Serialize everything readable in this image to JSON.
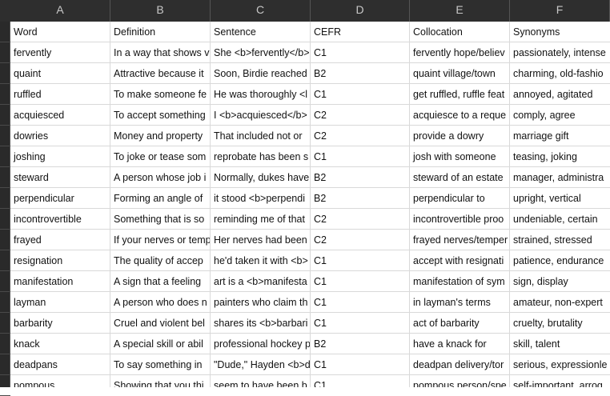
{
  "columns": [
    "A",
    "B",
    "C",
    "D",
    "E",
    "F"
  ],
  "header": [
    "Word",
    "Definition",
    "Sentence",
    "CEFR",
    "Collocation",
    "Synonyms"
  ],
  "rows": [
    [
      "fervently",
      "In a way that shows v",
      "She <b>fervently</b>",
      "C1",
      "fervently hope/believ",
      "passionately, intense"
    ],
    [
      "quaint",
      "Attractive because it",
      "Soon, Birdie reached",
      "B2",
      "quaint village/town",
      "charming, old-fashio"
    ],
    [
      "ruffled",
      "To make someone fe",
      "He was thoroughly <l",
      "C1",
      "get ruffled, ruffle feat",
      "annoyed, agitated"
    ],
    [
      "acquiesced",
      "To accept something",
      "I <b>acquiesced</b>",
      "C2",
      "acquiesce to a reque",
      "comply, agree"
    ],
    [
      "dowries",
      "Money and property",
      "That included not or",
      "C2",
      "provide a dowry",
      "marriage gift"
    ],
    [
      "joshing",
      "To joke or tease som",
      "reprobate has been s",
      "C1",
      "josh with someone",
      "teasing, joking"
    ],
    [
      "steward",
      "A person whose job i",
      "Normally, dukes have",
      "B2",
      "steward of an estate",
      "manager, administra"
    ],
    [
      "perpendicular",
      "Forming an angle of",
      "it stood <b>perpendi",
      "B2",
      "perpendicular to",
      "upright, vertical"
    ],
    [
      "incontrovertible",
      "Something that is so",
      "reminding me of that",
      "C2",
      "incontrovertible proo",
      "undeniable, certain"
    ],
    [
      "frayed",
      "If your nerves or temp",
      "Her nerves had been",
      "C2",
      "frayed nerves/temper",
      "strained, stressed"
    ],
    [
      "resignation",
      "The quality of accep",
      "he'd taken it with <b>",
      "C1",
      "accept with resignati",
      "patience, endurance"
    ],
    [
      "manifestation",
      "A sign that a feeling",
      "art is a <b>manifesta",
      "C1",
      "manifestation of sym",
      "sign, display"
    ],
    [
      "layman",
      "A person who does n",
      "painters who claim th",
      "C1",
      "in layman's terms",
      "amateur, non-expert"
    ],
    [
      "barbarity",
      "Cruel and violent bel",
      "shares its <b>barbari",
      "C1",
      "act of barbarity",
      "cruelty, brutality"
    ],
    [
      "knack",
      "A special skill or abil",
      "professional hockey p",
      "B2",
      "have a knack for",
      "skill, talent"
    ],
    [
      "deadpans",
      "To say something in",
      "\"Dude,\" Hayden <b>d",
      "C1",
      "deadpan delivery/tor",
      "serious, expressionle"
    ],
    [
      "pompous",
      "Showing that you thi",
      "seem to have been b",
      "C1",
      "pompous person/spe",
      "self-important, arrog"
    ]
  ]
}
